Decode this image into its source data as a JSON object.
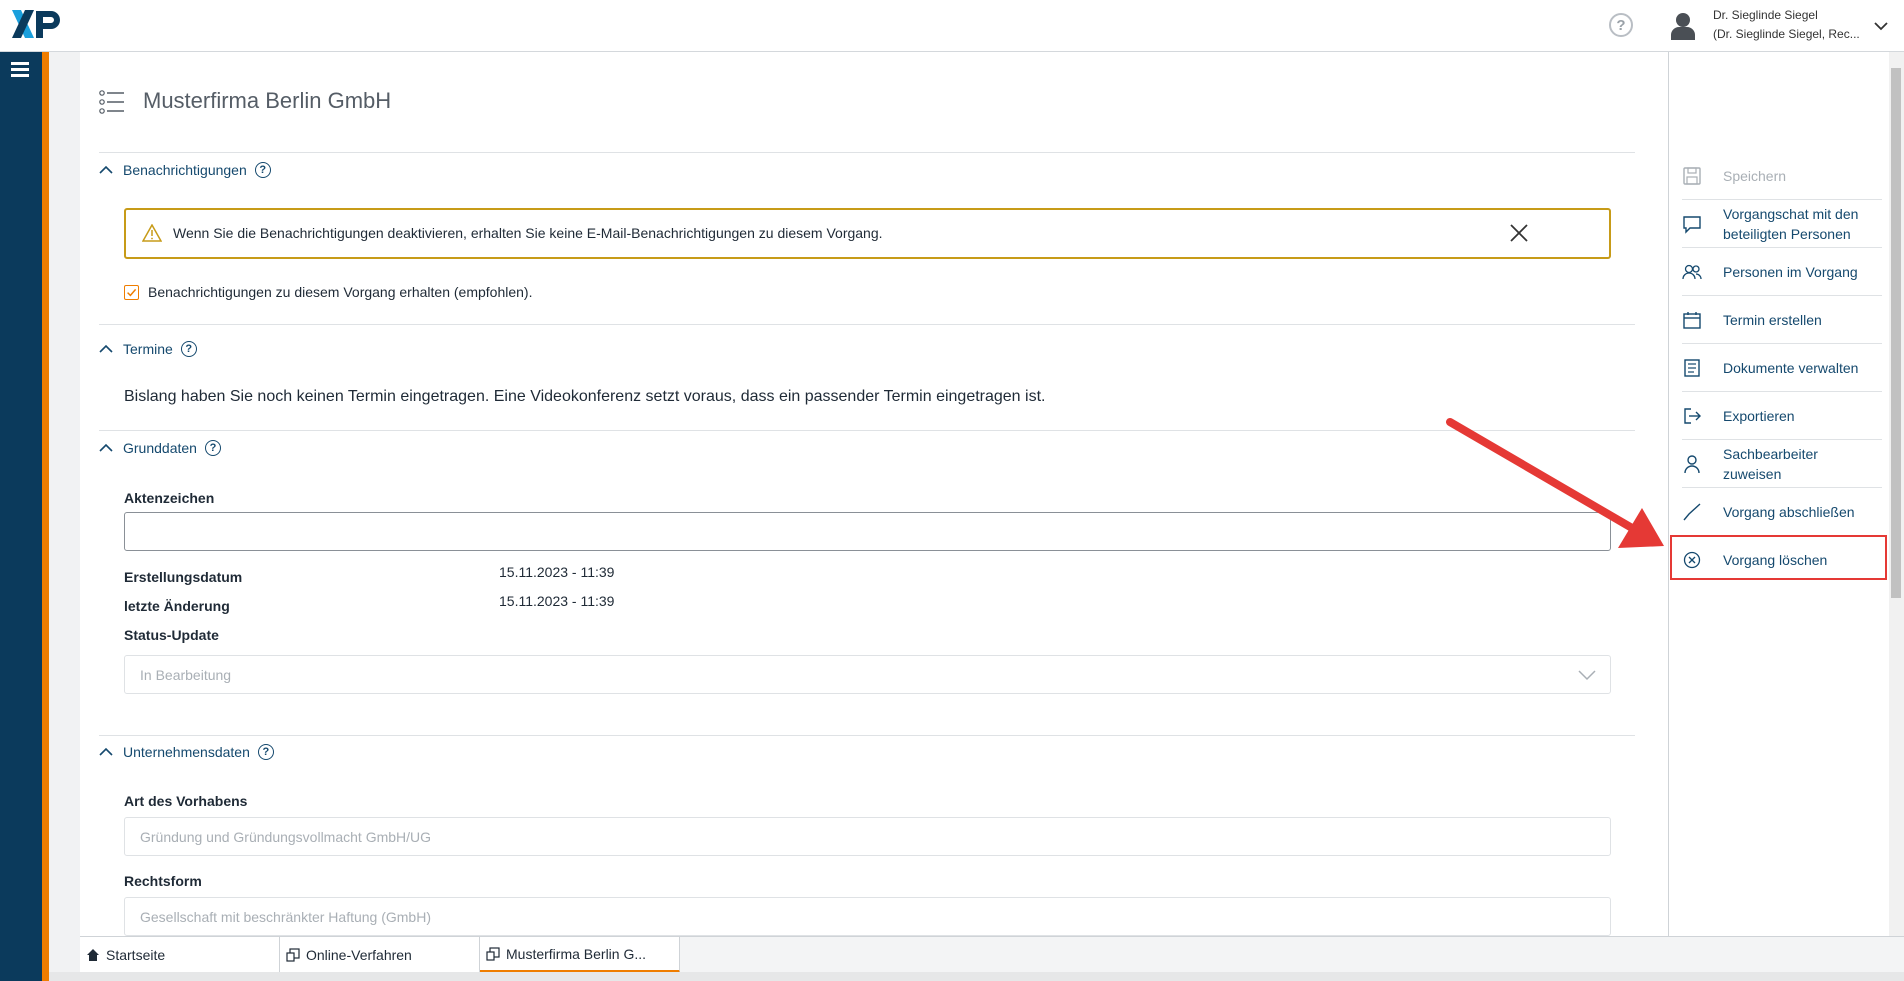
{
  "header": {
    "logo_text": "XP",
    "user_name": "Dr. Sieglinde Siegel",
    "user_role": "(Dr. Sieglinde Siegel, Rec..."
  },
  "page": {
    "title": "Musterfirma Berlin GmbH"
  },
  "benachrichtigungen": {
    "label": "Benachrichtigungen",
    "help": "?",
    "warning": "Wenn Sie die Benachrichtigungen deaktivieren, erhalten Sie keine E-Mail-Benachrichtigungen zu diesem Vorgang.",
    "checkbox_label": "Benachrichtigungen zu diesem Vorgang erhalten (empfohlen).",
    "checked": true
  },
  "termine": {
    "label": "Termine",
    "help": "?",
    "text": "Bislang haben Sie noch keinen Termin eingetragen. Eine Videokonferenz setzt voraus, dass ein passender Termin eingetragen ist."
  },
  "grunddaten": {
    "label": "Grunddaten",
    "help": "?",
    "aktenzeichen_label": "Aktenzeichen",
    "aktenzeichen_value": "",
    "erstellungsdatum_label": "Erstellungsdatum",
    "erstellungsdatum_value": "15.11.2023 - 11:39",
    "aenderung_label": "letzte Änderung",
    "aenderung_value": "15.11.2023 - 11:39",
    "status_label": "Status-Update",
    "status_value": "In Bearbeitung"
  },
  "unternehmensdaten": {
    "label": "Unternehmensdaten",
    "help": "?",
    "vorhaben_label": "Art des Vorhabens",
    "vorhaben_value": "Gründung und Gründungsvollmacht GmbH/UG",
    "rechtsform_label": "Rechtsform",
    "rechtsform_value": "Gesellschaft mit beschränkter Haftung (GmbH)"
  },
  "actions": {
    "speichern": "Speichern",
    "chat_line1": "Vorgangschat mit den",
    "chat_line2": "beteiligten Personen",
    "personen": "Personen im Vorgang",
    "termin": "Termin erstellen",
    "dokumente": "Dokumente verwalten",
    "exportieren": "Exportieren",
    "sachbearbeiter_line1": "Sachbearbeiter",
    "sachbearbeiter_line2": "zuweisen",
    "abschliessen": "Vorgang abschließen",
    "loeschen": "Vorgang löschen"
  },
  "tabs": {
    "startseite": "Startseite",
    "online": "Online-Verfahren",
    "musterfirma": "Musterfirma Berlin G..."
  },
  "colors": {
    "accent": "#ef7d00",
    "navy": "#0b3a5c",
    "link": "#15496e",
    "highlight": "#e53935"
  }
}
